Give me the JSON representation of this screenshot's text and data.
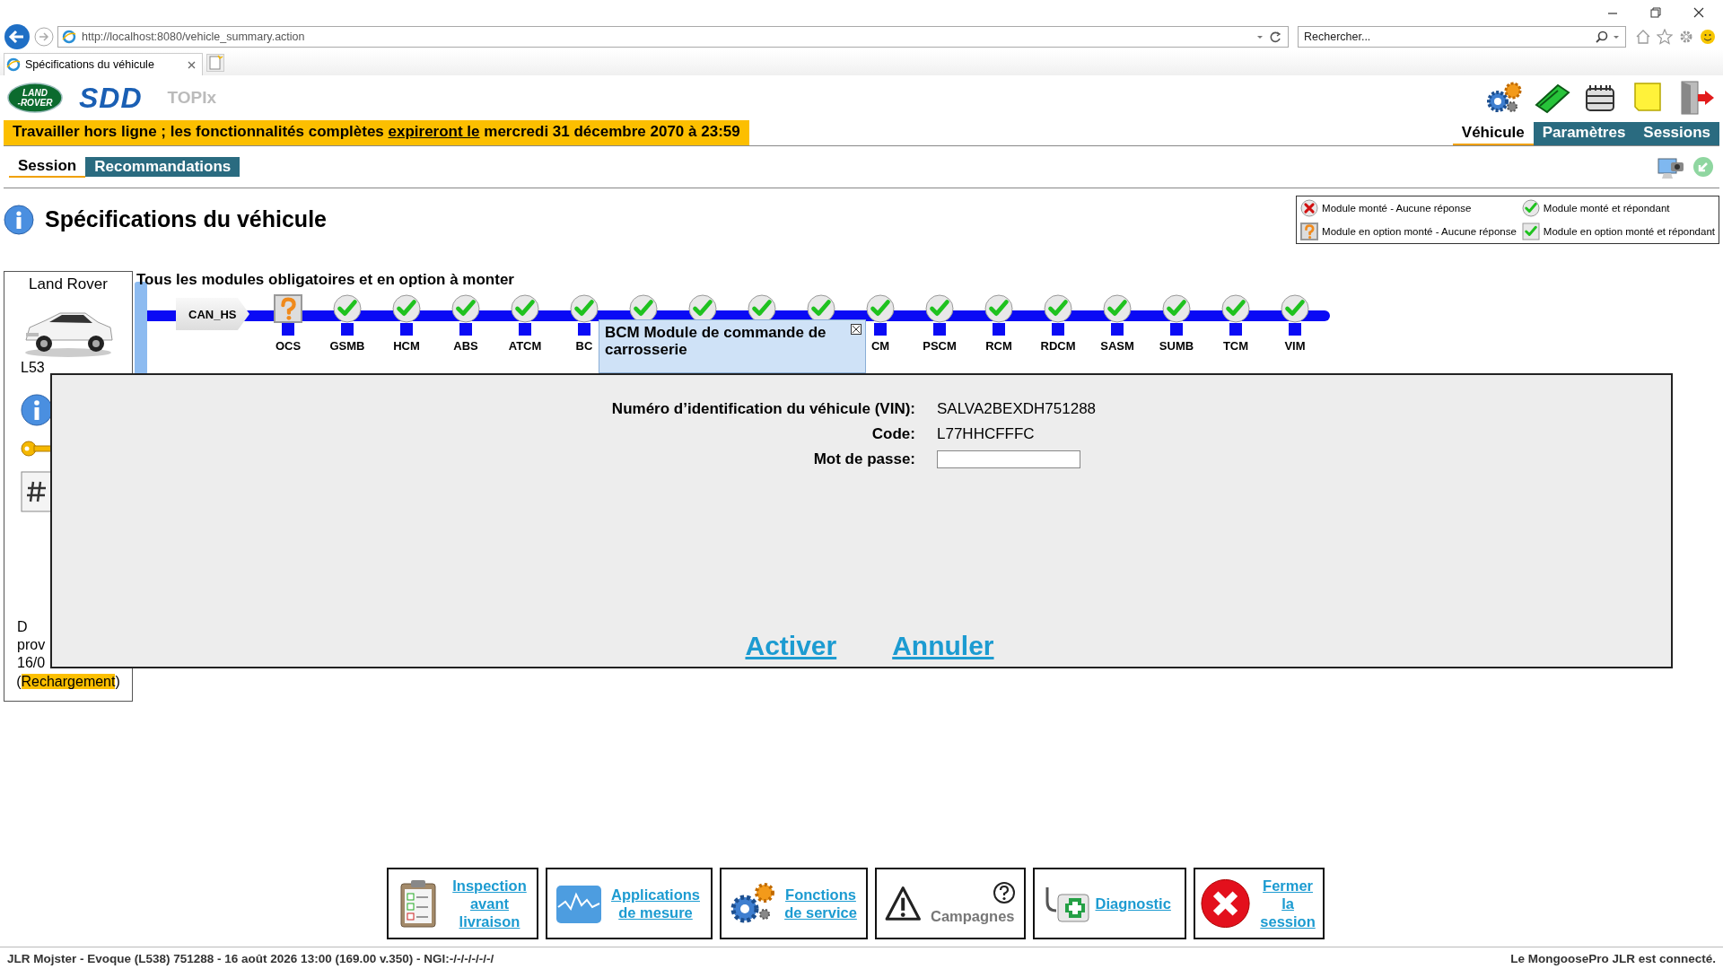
{
  "browser": {
    "url": "http://localhost:8080/vehicle_summary.action",
    "search": {
      "placeholder": "Rechercher..."
    },
    "tab": {
      "title": "Spécifications du véhicule",
      "selected": true
    }
  },
  "header": {
    "logo_lines": [
      "LAND",
      "-ROVER"
    ],
    "brand": "SDD",
    "product": "TOPIx"
  },
  "banner": {
    "before": "Travailler hors ligne ; les fonctionnalités complètes ",
    "link": "expireront le",
    "after": " mercredi 31 décembre 2070 à 23:59"
  },
  "main_tabs": [
    {
      "label": "Véhicule",
      "selected": true
    },
    {
      "label": "Paramètres",
      "selected": false
    },
    {
      "label": "Sessions",
      "selected": false
    }
  ],
  "sub_tabs": [
    {
      "label": "Session",
      "selected": true
    },
    {
      "label": "Recommandations",
      "selected": false
    }
  ],
  "page_title": "Spécifications du véhicule",
  "legend": [
    {
      "kind": "no_response",
      "label": "Module monté - Aucune réponse"
    },
    {
      "kind": "ok",
      "label": "Module monté et répondant"
    },
    {
      "kind": "optional_no_response",
      "label": "Module en option monté - Aucune réponse"
    },
    {
      "kind": "optional_ok",
      "label": "Module en option monté et répondant"
    }
  ],
  "vehicle_panel": {
    "make": "Land Rover",
    "model": "L53",
    "notes": [
      "D",
      "prov",
      "16/0"
    ],
    "reload_prefix": "(",
    "reload": "Rechargement",
    "reload_suffix": ")"
  },
  "modules": {
    "title": "Tous les modules obligatoires et en option à monter",
    "bus": "CAN_HS",
    "items": [
      {
        "label": "OCS",
        "kind": "optional_no_response"
      },
      {
        "label": "GSMB",
        "kind": "ok"
      },
      {
        "label": "HCM",
        "kind": "ok"
      },
      {
        "label": "ABS",
        "kind": "ok"
      },
      {
        "label": "ATCM",
        "kind": "ok"
      },
      {
        "label": "BC",
        "kind": "ok"
      },
      {
        "kind": "ok"
      },
      {
        "kind": "ok"
      },
      {
        "kind": "ok"
      },
      {
        "kind": "ok"
      },
      {
        "label": "CM",
        "kind": "ok"
      },
      {
        "label": "PSCM",
        "kind": "ok"
      },
      {
        "label": "RCM",
        "kind": "ok"
      },
      {
        "label": "RDCM",
        "kind": "ok"
      },
      {
        "label": "SASM",
        "kind": "ok"
      },
      {
        "label": "SUMB",
        "kind": "ok"
      },
      {
        "label": "TCM",
        "kind": "ok"
      },
      {
        "label": "VIM",
        "kind": "ok"
      }
    ],
    "tooltip": {
      "title": "BCM Module de commande de carrosserie"
    }
  },
  "dialog": {
    "fields": [
      {
        "kind": "text",
        "label": "Numéro d’identification du véhicule (VIN):",
        "value": "SALVA2BEXDH751288"
      },
      {
        "kind": "text",
        "label": "Code:",
        "value": "L77HHCFFFC"
      },
      {
        "kind": "input",
        "label": "Mot de passe:"
      }
    ],
    "actions": [
      "Activer",
      "Annuler"
    ]
  },
  "toolbar": [
    {
      "kind": "checklist",
      "label": "Inspection avant livraison",
      "disabled": false
    },
    {
      "kind": "chart",
      "label": "Applications de mesure",
      "disabled": false
    },
    {
      "kind": "gears",
      "label": "Fonctions de service",
      "disabled": false
    },
    {
      "kind": "warning",
      "label": "Campagnes",
      "disabled": true
    },
    {
      "kind": "medkit",
      "label": "Diagnostic",
      "disabled": false
    },
    {
      "kind": "close",
      "label": "Fermer la session",
      "disabled": false
    }
  ],
  "status_bar": {
    "left": "JLR Mojster - Evoque (L538) 751288 - 16 août 2026 13:00 (169.00 v.350) - NGI:-/-/-/-/-/-/",
    "right": "Le MongoosePro JLR est connecté."
  }
}
